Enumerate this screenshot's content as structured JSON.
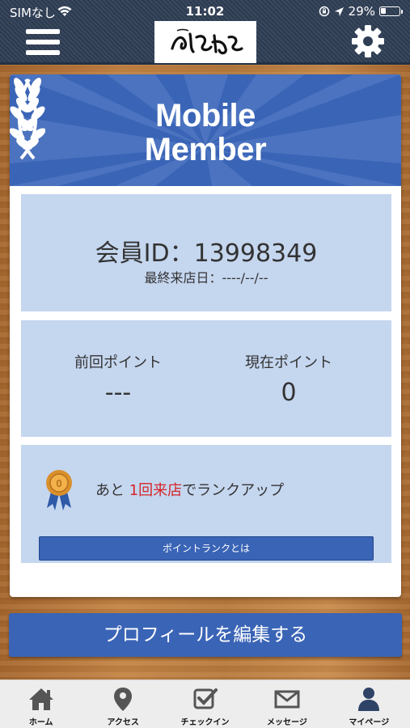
{
  "status_bar": {
    "carrier": "SIMなし",
    "time": "11:02",
    "battery": "29%",
    "battery_level": 0.29
  },
  "header": {
    "menu_icon": "hamburger-menu-icon",
    "logo_text": "ぐっさん",
    "settings_icon": "gear-icon"
  },
  "banner": {
    "title_line1": "Mobile",
    "title_line2": "Member"
  },
  "member": {
    "id_label": "会員ID：13998349",
    "last_visit": "最終来店日：----/--/--"
  },
  "points": {
    "previous_label": "前回ポイント",
    "previous_value": "---",
    "current_label": "現在ポイント",
    "current_value": "0"
  },
  "rank": {
    "text_prefix": "あと ",
    "text_highlight": "1回来店",
    "text_suffix": "でランクアップ",
    "medal_number": "0",
    "button_label": "ポイントランクとは"
  },
  "edit_profile_label": "プロフィールを編集する",
  "tabs": [
    {
      "label": "ホーム",
      "icon": "home-icon"
    },
    {
      "label": "アクセス",
      "icon": "map-pin-icon"
    },
    {
      "label": "チェックイン",
      "icon": "checkin-icon"
    },
    {
      "label": "メッセージ",
      "icon": "envelope-icon"
    },
    {
      "label": "マイページ",
      "icon": "user-icon"
    }
  ],
  "colors": {
    "accent_blue": "#3a64b6",
    "panel_blue": "#c5d6ef",
    "highlight_red": "#d6252a",
    "header_navy": "#2f3e55"
  }
}
